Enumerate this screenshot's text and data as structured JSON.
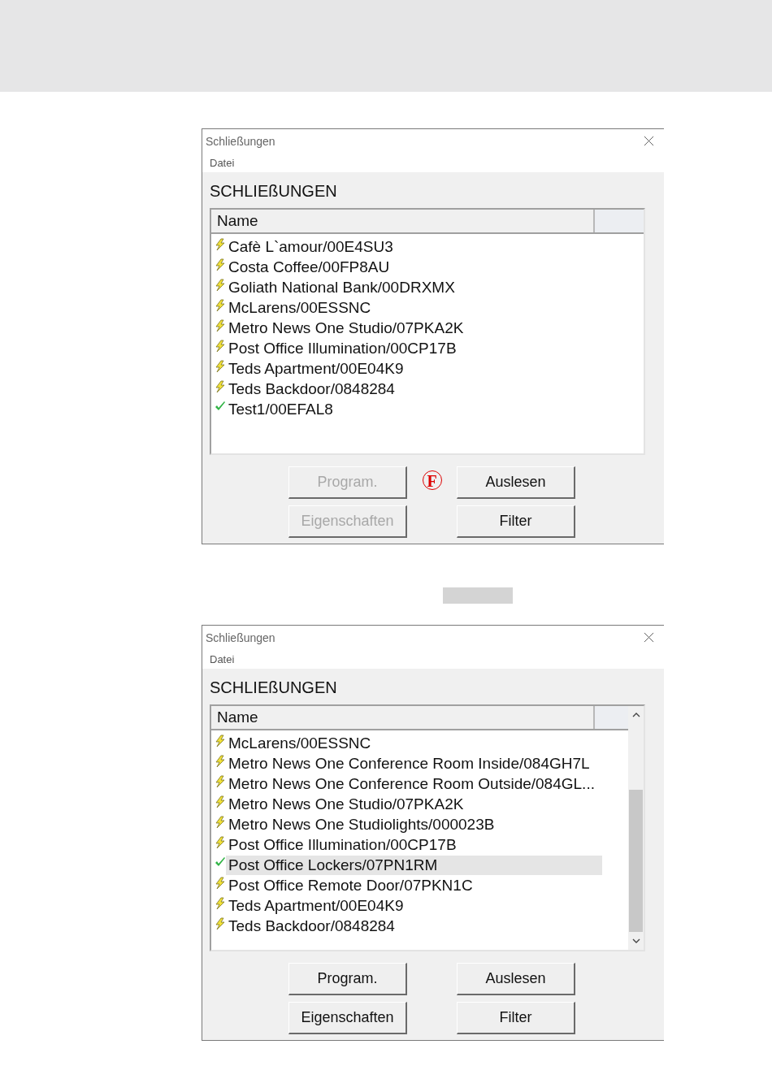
{
  "dialogs": [
    {
      "title": "Schließungen",
      "menu": [
        "Datei"
      ],
      "heading": "SCHLIEßUNGEN",
      "column": "Name",
      "scrollable": false,
      "rows": [
        {
          "label": "Cafè L`amour/00E4SU3",
          "kind": "pending",
          "selected": false
        },
        {
          "label": "Costa Coffee/00FP8AU",
          "kind": "pending",
          "selected": false
        },
        {
          "label": "Goliath National Bank/00DRXMX",
          "kind": "pending",
          "selected": false
        },
        {
          "label": "McLarens/00ESSNC",
          "kind": "pending",
          "selected": false
        },
        {
          "label": "Metro News One Studio/07PKA2K",
          "kind": "pending",
          "selected": false
        },
        {
          "label": "Post Office Illumination/00CP17B",
          "kind": "pending",
          "selected": false
        },
        {
          "label": "Teds Apartment/00E04K9",
          "kind": "pending",
          "selected": false
        },
        {
          "label": "Teds Backdoor/0848284",
          "kind": "pending",
          "selected": false
        },
        {
          "label": "Test1/00EFAL8",
          "kind": "done",
          "selected": false
        }
      ],
      "badge": "F",
      "buttons": [
        {
          "label": "Program.",
          "disabled": true
        },
        {
          "label": "Auslesen",
          "disabled": false
        },
        {
          "label": "Eigenschaften",
          "disabled": true
        },
        {
          "label": "Filter",
          "disabled": false
        }
      ]
    },
    {
      "title": "Schließungen",
      "menu": [
        "Datei"
      ],
      "heading": "SCHLIEßUNGEN",
      "column": "Name",
      "scrollable": true,
      "rows": [
        {
          "label": "McLarens/00ESSNC",
          "kind": "pending",
          "selected": false
        },
        {
          "label": "Metro News One Conference Room Inside/084GH7L",
          "kind": "pending",
          "selected": false
        },
        {
          "label": "Metro News One Conference Room Outside/084GL...",
          "kind": "pending",
          "selected": false
        },
        {
          "label": "Metro News One Studio/07PKA2K",
          "kind": "pending",
          "selected": false
        },
        {
          "label": "Metro News One Studiolights/000023B",
          "kind": "pending",
          "selected": false
        },
        {
          "label": "Post Office Illumination/00CP17B",
          "kind": "pending",
          "selected": false
        },
        {
          "label": "Post Office Lockers/07PN1RM",
          "kind": "done",
          "selected": true
        },
        {
          "label": "Post Office Remote Door/07PKN1C",
          "kind": "pending",
          "selected": false
        },
        {
          "label": "Teds Apartment/00E04K9",
          "kind": "pending",
          "selected": false
        },
        {
          "label": "Teds Backdoor/0848284",
          "kind": "pending",
          "selected": false
        }
      ],
      "buttons": [
        {
          "label": "Program.",
          "disabled": false
        },
        {
          "label": "Auslesen",
          "disabled": false
        },
        {
          "label": "Eigenschaften",
          "disabled": false
        },
        {
          "label": "Filter",
          "disabled": false
        }
      ]
    }
  ]
}
